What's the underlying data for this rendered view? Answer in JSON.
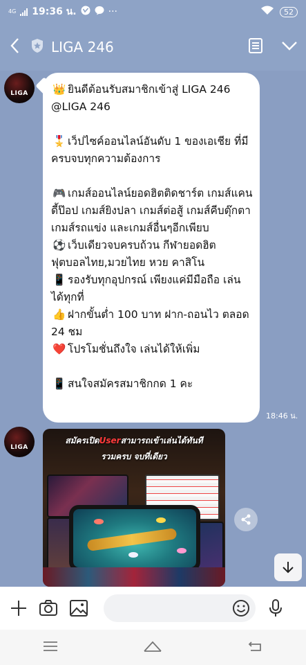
{
  "status_bar": {
    "network": "4G",
    "time": "19:36 น.",
    "battery": "52",
    "more": "···"
  },
  "header": {
    "title": "LIGA 246",
    "back_icon": "chevron-left-icon",
    "shield_icon": "shield-star-icon",
    "notes_icon": "notes-icon",
    "menu_icon": "chevron-down-icon"
  },
  "messages": [
    {
      "avatar_label": "LIGA",
      "time": "18:46 น.",
      "lines": [
        {
          "emoji": "👑",
          "text": "ยินดีต้อนรับสมาชิกเข้าสู่ LIGA 246  @LIGA 246"
        },
        {
          "emoji": "🎖️",
          "text": "เว็ปไซค์ออนไลน์อันดับ 1 ของเอเชีย ที่มีครบจบทุกความต้องการ"
        },
        {
          "emoji": "🎮",
          "text": "เกมส์ออนไลน์ยอดฮิตติดชาร์ต เกมส์แคนดี้ป๊อป เกมส์ยิงปลา เกมส์ต่อสู้ เกมส์คีบตุ๊กตา เกมส์รถแข่ง และเกมส์อื่นๆอีกเพียบ"
        },
        {
          "emoji": "⚽",
          "text": "เว็บเดียวจบครบถ้วน กีฬายอดฮิต ฟุตบอลไทย,มวยไทย หวย คาสิโน"
        },
        {
          "emoji": "📱",
          "text": "รองรับทุกอุปกรณ์ เพียงแค่มีมือถือ เล่นได้ทุกที่"
        },
        {
          "emoji": "👍",
          "text": "ฝากขั้นต่ำ 100 บาท ฝาก-ถอนไว ตลอด 24 ชม"
        },
        {
          "emoji": "❤️",
          "text": "โปรโมชั่นถึงใจ เล่นได้ให้เพิ่ม"
        },
        {
          "emoji": "📱",
          "text": "สนใจสมัครสมาชิกกด 1 คะ"
        }
      ]
    },
    {
      "avatar_label": "LIGA",
      "image_caption_line1_pre": "สมัครเปิด",
      "image_caption_line1_user": "User",
      "image_caption_line1_post": "สามารถเข้าเล่นได้ทันที",
      "image_caption_line2": "รวมครบ จบที่เดียว"
    }
  ],
  "input_bar": {
    "placeholder": "",
    "icons": [
      "plus-icon",
      "camera-icon",
      "image-icon",
      "emoji-icon",
      "microphone-icon"
    ]
  },
  "colors": {
    "chat_background": "#8a9ec2",
    "header_background": "#8ea3c6",
    "bubble": "#ffffff"
  }
}
